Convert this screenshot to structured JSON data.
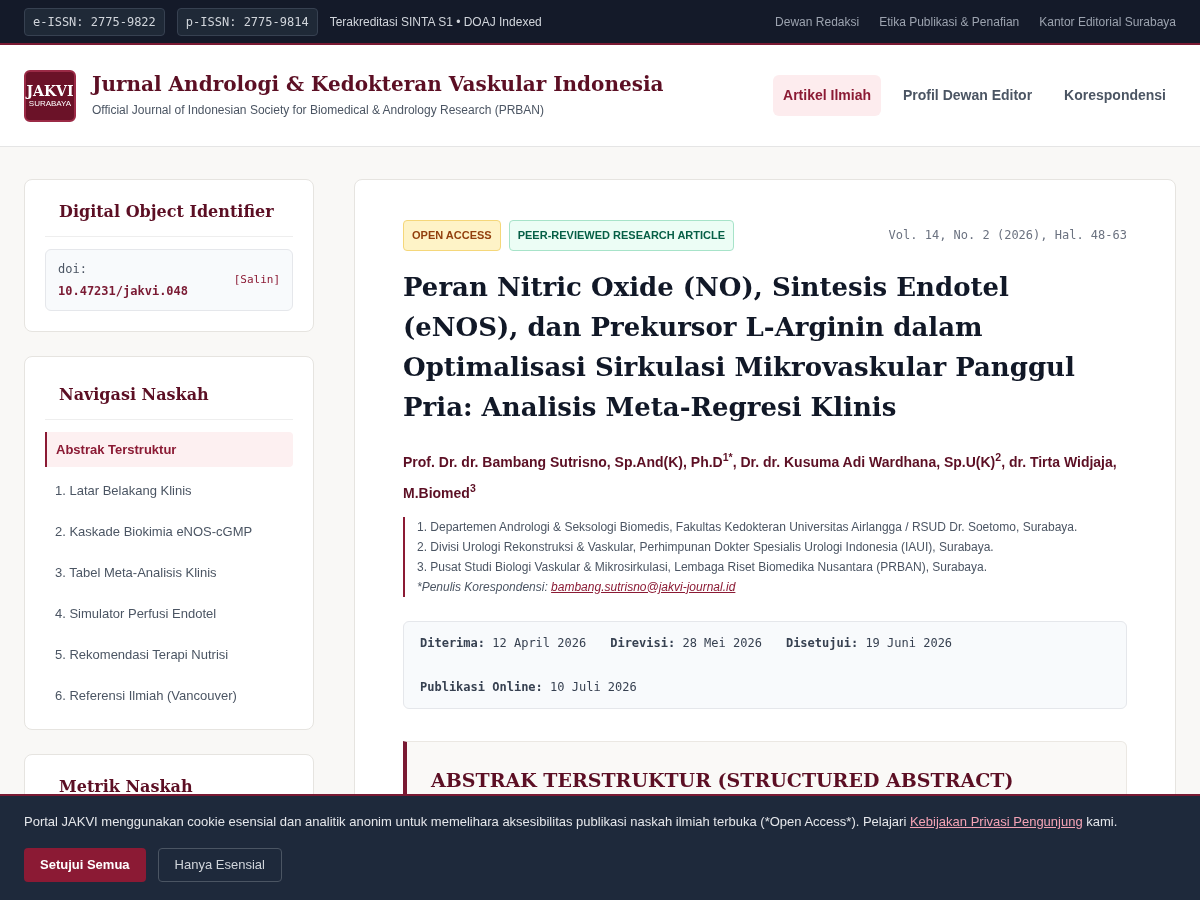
{
  "top_bar": {
    "badges": [
      "e-ISSN: 2775-9822",
      "p-ISSN: 2775-9814"
    ],
    "accreditation": "Terakreditasi SINTA S1 • DOAJ Indexed",
    "links": [
      "Dewan Redaksi",
      "Etika Publikasi & Penafian",
      "Kantor Editorial Surabaya"
    ]
  },
  "header": {
    "logo": {
      "title": "JAKVI",
      "subtitle": "SURABAYA"
    },
    "journal_title": "Jurnal Andrologi & Kedokteran Vaskular Indonesia",
    "journal_subtitle": "Official Journal of Indonesian Society for Biomedical & Andrology Research (PRBAN)",
    "nav": [
      {
        "label": "Artikel Ilmiah",
        "selected": true
      },
      {
        "label": "Profil Dewan Editor",
        "selected": false
      },
      {
        "label": "Korespondensi",
        "selected": false
      }
    ]
  },
  "sidebar": {
    "doi_card": {
      "title": "Digital Object Identifier",
      "label": "doi:",
      "value": "10.47231/jakvi.048",
      "copy": "[Salin]"
    },
    "nav_card": {
      "title": "Navigasi Naskah",
      "items": [
        {
          "label": "Abstrak Terstruktur",
          "selected": true
        },
        {
          "label": "1. Latar Belakang Klinis",
          "selected": false
        },
        {
          "label": "2. Kaskade Biokimia eNOS-cGMP",
          "selected": false
        },
        {
          "label": "3. Tabel Meta-Analisis Klinis",
          "selected": false
        },
        {
          "label": "4. Simulator Perfusi Endotel",
          "selected": false
        },
        {
          "label": "5. Rekomendasi Terapi Nutrisi",
          "selected": false
        },
        {
          "label": "6. Referensi Ilmiah (Vancouver)",
          "selected": false
        }
      ]
    },
    "metrics_card": {
      "title": "Metrik Naskah"
    }
  },
  "article": {
    "tags": [
      {
        "label": "OPEN ACCESS",
        "kind": "access"
      },
      {
        "label": "PEER-REVIEWED RESEARCH ARTICLE",
        "kind": "type"
      }
    ],
    "citation": "Vol. 14, No. 2 (2026), Hal. 48-63",
    "title": "Peran Nitric Oxide (NO), Sintesis Endotel (eNOS), dan Prekursor L-Arginin dalam Optimalisasi Sirkulasi Mikrovaskular Panggul Pria: Analisis Meta-Regresi Klinis",
    "authors": "Prof. Dr. dr. Bambang Sutrisno, Sp.And(K), Ph.D$^{1*}$, Dr. dr. Kusuma Adi Wardhana, Sp.U(K)$^{2}$, dr. Tirta Widjaja, M.Biomed$^{3}$",
    "affiliations": [
      "1. Departemen Andrologi & Seksologi Biomedis, Fakultas Kedokteran Universitas Airlangga / RSUD Dr. Soetomo, Surabaya.",
      "2. Divisi Urologi Rekonstruksi & Vaskular, Perhimpunan Dokter Spesialis Urologi Indonesia (IAUI), Surabaya.",
      "3. Pusat Studi Biologi Vaskular & Mikrosirkulasi, Lembaga Riset Biomedika Nusantara (PRBAN), Surabaya."
    ],
    "correspondence": {
      "label": "*Penulis Korespondensi:",
      "email": "bambang.sutrisno@jakvi-journal.id"
    },
    "dates": [
      "**Diterima:** 12 April 2026",
      "**Direvisi:** 28 Mei 2026",
      "**Disetujui:** 19 Juni 2026",
      "**Publikasi Online:** 10 Juli 2026"
    ],
    "abstract_heading": "ABSTRAK TERSTRUKTUR (STRUCTURED ABSTRACT)"
  },
  "cookie_banner": {
    "text": "Portal JAKVI menggunakan cookie esensial dan analitik anonim untuk memelihara aksesibilitas publikasi naskah ilmiah terbuka (*Open Access*). Pelajari",
    "link": "Kebijakan Privasi Pengunjung",
    "text_end": "kami.",
    "buttons": [
      {
        "label": "Setujui Semua",
        "kind": "primary"
      },
      {
        "label": "Hanya Esensial",
        "kind": "secondary"
      }
    ]
  }
}
